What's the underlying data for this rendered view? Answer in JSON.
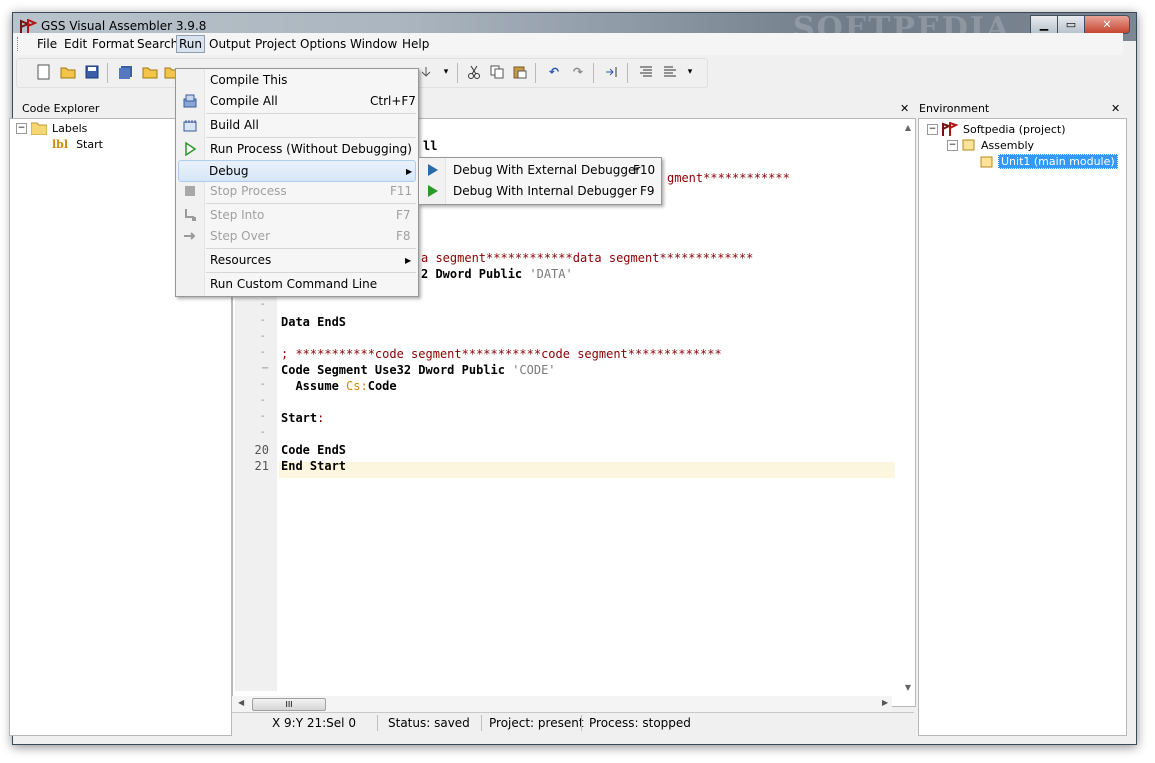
{
  "window": {
    "title": "GSS Visual Assembler 3.9.8",
    "watermark": "SOFTPEDIA"
  },
  "menubar": {
    "items": [
      "File",
      "Edit",
      "Format",
      "Search",
      "Run",
      "Output",
      "Project",
      "Options",
      "Window",
      "Help"
    ],
    "active": "Run"
  },
  "code_explorer": {
    "title": "Code Explorer",
    "root": "Labels",
    "child": "Start",
    "child_icon_text": "lbl"
  },
  "environment": {
    "title": "Environment",
    "project": "Softpedia (project)",
    "folder": "Assembly",
    "unit": "Unit1 (main module)"
  },
  "editor": {
    "line1_partial": "ll",
    "line_comment1": "gment************",
    "line_comment2": "a segment************data segment*************",
    "line_data_seg_partial": "2 Dword Public ",
    "line_data_seg_str": "'DATA'",
    "data_ends": "Data EndS",
    "comment_code_a": "; ***********code segment***********code segment*************",
    "code_seg": "Code Segment Use32 Dword Public ",
    "code_seg_str": "'CODE'",
    "assume_a": "  Assume ",
    "assume_reg": "Cs:",
    "assume_b": "Code",
    "start": "Start",
    "start_colon": ":",
    "code_ends": "Code EndS",
    "end_start": "End Start",
    "line_numbers": [
      "20",
      "21"
    ]
  },
  "run_menu": [
    {
      "label": "Compile This",
      "shortcut": "",
      "icon": "",
      "disabled": false
    },
    {
      "label": "Compile All",
      "shortcut": "Ctrl+F7",
      "icon": "compile-all-icon",
      "disabled": false
    },
    {
      "label": "Build All",
      "shortcut": "",
      "icon": "build-all-icon",
      "disabled": false
    },
    {
      "label": "Run Process (Without Debugging)",
      "shortcut": "",
      "icon": "run-icon",
      "disabled": false
    },
    {
      "label": "Debug",
      "shortcut": "",
      "icon": "",
      "disabled": false
    },
    {
      "label": "Stop Process",
      "shortcut": "F11",
      "icon": "stop-icon",
      "disabled": true
    },
    {
      "label": "Step Into",
      "shortcut": "F7",
      "icon": "step-into-icon",
      "disabled": true
    },
    {
      "label": "Step Over",
      "shortcut": "F8",
      "icon": "step-over-icon",
      "disabled": true
    },
    {
      "label": "Resources",
      "shortcut": "",
      "icon": "",
      "disabled": false
    },
    {
      "label": "Run Custom Command Line",
      "shortcut": "",
      "icon": "",
      "disabled": false
    }
  ],
  "debug_submenu": [
    {
      "label": "Debug With External Debugger",
      "shortcut": "F10"
    },
    {
      "label": "Debug With Internal Debugger",
      "shortcut": "F9"
    }
  ],
  "status": {
    "position": "X 9:Y 21:Sel 0",
    "status": "Status: saved",
    "project": "Project: present",
    "process": "Process: stopped"
  },
  "scrollbar": {
    "thumb_text": "III"
  }
}
